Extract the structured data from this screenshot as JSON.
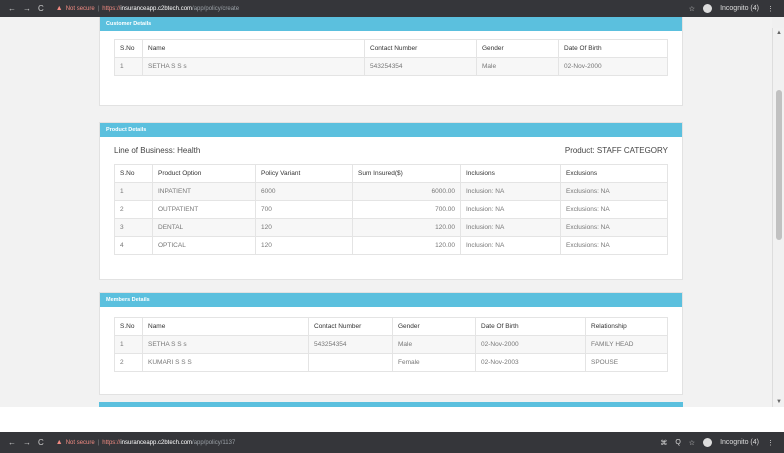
{
  "browser_top": {
    "nav": [
      "←",
      "→",
      "C"
    ],
    "warning": "▲",
    "not_secure": "Not secure",
    "https": "https://",
    "host": "insuranceapp.c2btech.com",
    "path": "/app/policy/create",
    "star": "☆",
    "incognito": "Incognito (4)",
    "menu": "⋮"
  },
  "browser_bottom": {
    "nav": [
      "←",
      "→",
      "C"
    ],
    "warning": "▲",
    "not_secure": "Not secure",
    "https": "https://",
    "host": "insuranceapp.c2btech.com",
    "path": "/app/policy/1137",
    "icons": [
      "⌘",
      "Q",
      "☆"
    ],
    "incognito": "Incognito (4)",
    "menu": "⋮"
  },
  "customer": {
    "title": "Customer Details",
    "headers": [
      "S.No",
      "Name",
      "Contact Number",
      "Gender",
      "Date Of Birth"
    ],
    "rows": [
      [
        "1",
        "SETHA S S s",
        "543254354",
        "Male",
        "02-Nov-2000"
      ]
    ]
  },
  "product": {
    "title": "Product Details",
    "line_of_business": "Line of Business: Health",
    "product_label": "Product: STAFF CATEGORY",
    "headers": [
      "S.No",
      "Product Option",
      "Policy Variant",
      "Sum Insured($)",
      "Inclusions",
      "Exclusions"
    ],
    "rows": [
      [
        "1",
        "INPATIENT",
        "6000",
        "6000.00",
        "Inclusion:  NA",
        "Exclusions:  NA"
      ],
      [
        "2",
        "OUTPATIENT",
        "700",
        "700.00",
        "Inclusion:  NA",
        "Exclusions:  NA"
      ],
      [
        "3",
        "DENTAL",
        "120",
        "120.00",
        "Inclusion:  NA",
        "Exclusions:  NA"
      ],
      [
        "4",
        "OPTICAL",
        "120",
        "120.00",
        "Inclusion:  NA",
        "Exclusions:  NA"
      ]
    ]
  },
  "members": {
    "title": "Members Details",
    "headers": [
      "S.No",
      "Name",
      "Contact Number",
      "Gender",
      "Date Of Birth",
      "Relationship"
    ],
    "rows": [
      [
        "1",
        "SETHA S S s",
        "543254354",
        "Male",
        "02-Nov-2000",
        "FAMILY HEAD"
      ],
      [
        "2",
        "KUMARI S S S",
        "",
        "Female",
        "02-Nov-2003",
        "SPOUSE"
      ]
    ]
  },
  "colors": {
    "panel_header": "#5bc0de",
    "chrome": "#35363a"
  }
}
